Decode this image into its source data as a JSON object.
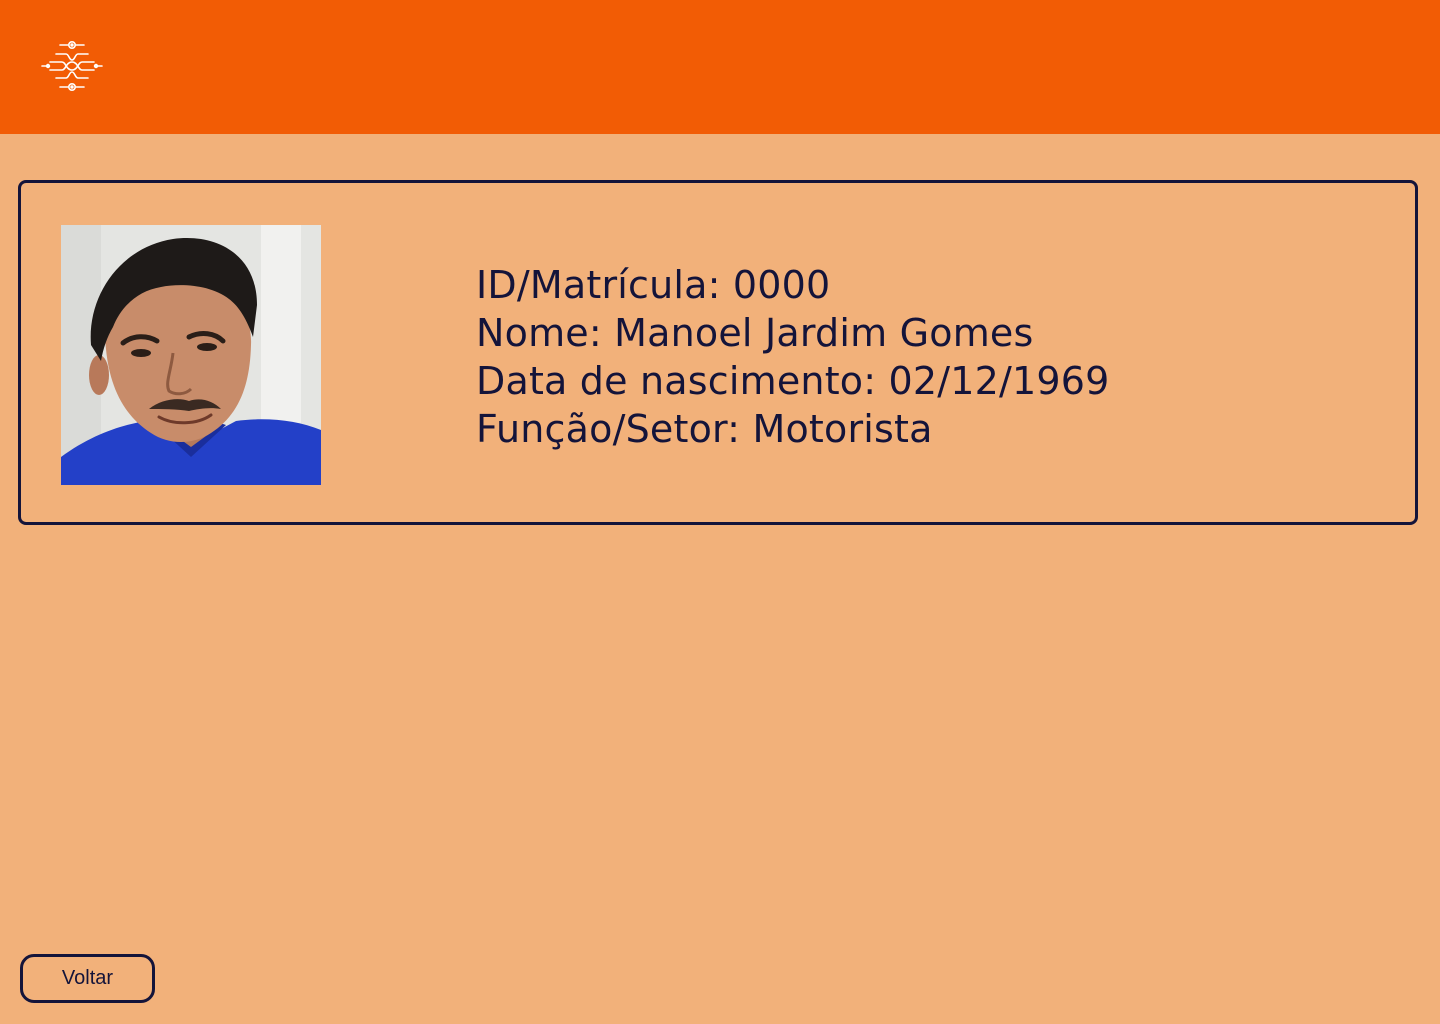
{
  "header": {
    "background_color": "#F25C05",
    "logo_icon": "circuit-logo-icon"
  },
  "profile": {
    "photo_icon": "employee-photo",
    "id_line": "ID/Matrícula: 0000",
    "name_line": "Nome: Manoel Jardim Gomes",
    "birth_line": "Data de nascimento: 02/12/1969",
    "role_line": "Função/Setor: Motorista"
  },
  "footer": {
    "back_label": "Voltar"
  },
  "colors": {
    "page_background": "#F2B17A",
    "text": "#14143A",
    "accent": "#F25C05"
  }
}
